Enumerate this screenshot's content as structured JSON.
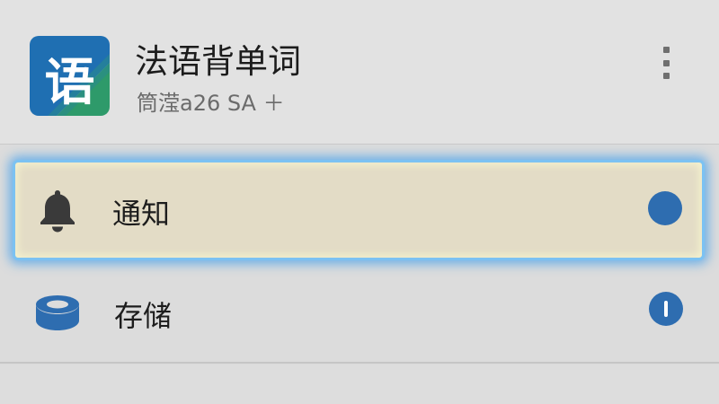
{
  "app": {
    "logo_char": "语",
    "title": "法语背单词",
    "subtitle": "筒滢a26 SA ＋",
    "colors": {
      "logo_blue": "#1f6fb2",
      "logo_green": "#2e9a6a"
    }
  },
  "header": {
    "menu_icon": "more-vertical-icon"
  },
  "settings": {
    "items": [
      {
        "label": "通知",
        "icon": "bell-icon",
        "status_icon": "dot-indicator",
        "highlighted": true
      },
      {
        "label": "存储",
        "icon": "storage-icon",
        "status_icon": "info-icon",
        "highlighted": false
      }
    ]
  },
  "colors": {
    "accent": "#2e6db0",
    "highlight_glow": "#7cc2f2",
    "highlight_fill": "#e3dcc6",
    "background": "#dcdcdc"
  }
}
